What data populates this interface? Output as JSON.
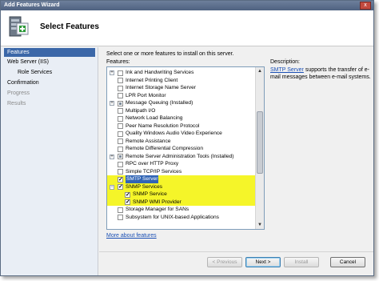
{
  "window": {
    "title": "Add Features Wizard",
    "close_label": "x"
  },
  "header": {
    "title": "Select Features",
    "icon": "server-features-icon"
  },
  "sidebar": {
    "items": [
      {
        "label": "Features",
        "state": "active"
      },
      {
        "label": "Web Server (IIS)",
        "state": "normal"
      },
      {
        "label": "Role Services",
        "state": "normal"
      },
      {
        "label": "Confirmation",
        "state": "normal"
      },
      {
        "label": "Progress",
        "state": "disabled"
      },
      {
        "label": "Results",
        "state": "disabled"
      }
    ]
  },
  "main": {
    "prompt": "Select one or more features to install on this server.",
    "features_label": "Features:",
    "description_label": "Description:",
    "description_link": "SMTP Server",
    "description_text": " supports the transfer of e-mail messages between e-mail systems.",
    "more_link": "More about features",
    "features": [
      {
        "label": "Ink and Handwriting Services",
        "expander": "+",
        "checked": false
      },
      {
        "label": "Internet Printing Client",
        "expander": "",
        "checked": false
      },
      {
        "label": "Internet Storage Name Server",
        "expander": "",
        "checked": false
      },
      {
        "label": "LPR Port Monitor",
        "expander": "",
        "checked": false
      },
      {
        "label": "Message Queuing  (Installed)",
        "expander": "+",
        "checked": "partial"
      },
      {
        "label": "Multipath I/O",
        "expander": "",
        "checked": false
      },
      {
        "label": "Network Load Balancing",
        "expander": "",
        "checked": false
      },
      {
        "label": "Peer Name Resolution Protocol",
        "expander": "",
        "checked": false
      },
      {
        "label": "Quality Windows Audio Video Experience",
        "expander": "",
        "checked": false
      },
      {
        "label": "Remote Assistance",
        "expander": "",
        "checked": false
      },
      {
        "label": "Remote Differential Compression",
        "expander": "",
        "checked": false
      },
      {
        "label": "Remote Server Administration Tools  (Installed)",
        "expander": "+",
        "checked": "partial"
      },
      {
        "label": "RPC over HTTP Proxy",
        "expander": "",
        "checked": false
      },
      {
        "label": "Simple TCP/IP Services",
        "expander": "",
        "checked": false
      },
      {
        "label": "SMTP Server",
        "expander": "",
        "checked": true,
        "highlight": true,
        "selected": true
      },
      {
        "label": "SNMP Services",
        "expander": "−",
        "checked": true,
        "highlight": true
      },
      {
        "label": "SNMP Service",
        "expander": "",
        "checked": true,
        "highlight": true,
        "indent": 1
      },
      {
        "label": "SNMP WMI Provider",
        "expander": "",
        "checked": true,
        "highlight": true,
        "indent": 1
      },
      {
        "label": "Storage Manager for SANs",
        "expander": "",
        "checked": false
      },
      {
        "label": "Subsystem for UNIX-based Applications",
        "expander": "",
        "checked": false
      }
    ]
  },
  "buttons": {
    "previous": "< Previous",
    "next": "Next >",
    "install": "Install",
    "cancel": "Cancel"
  },
  "colors": {
    "highlight": "#f5f529",
    "selection": "#3165b5",
    "sidebar_active": "#3b67a8"
  }
}
